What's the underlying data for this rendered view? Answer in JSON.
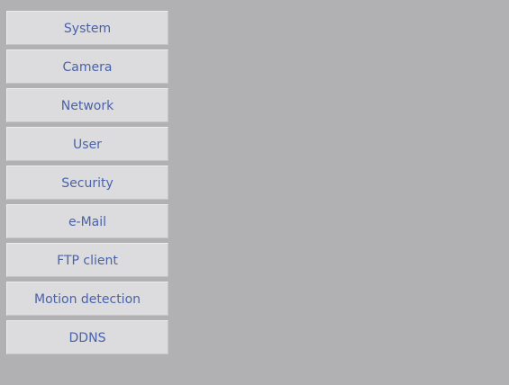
{
  "colors": {
    "background": "#b1b1b4",
    "button_bg": "#dcdcde",
    "button_text": "#4a62a8"
  },
  "menu": {
    "items": [
      {
        "label": "System"
      },
      {
        "label": "Camera"
      },
      {
        "label": "Network"
      },
      {
        "label": "User"
      },
      {
        "label": "Security"
      },
      {
        "label": "e-Mail"
      },
      {
        "label": "FTP client"
      },
      {
        "label": "Motion detection"
      },
      {
        "label": "DDNS"
      }
    ]
  }
}
